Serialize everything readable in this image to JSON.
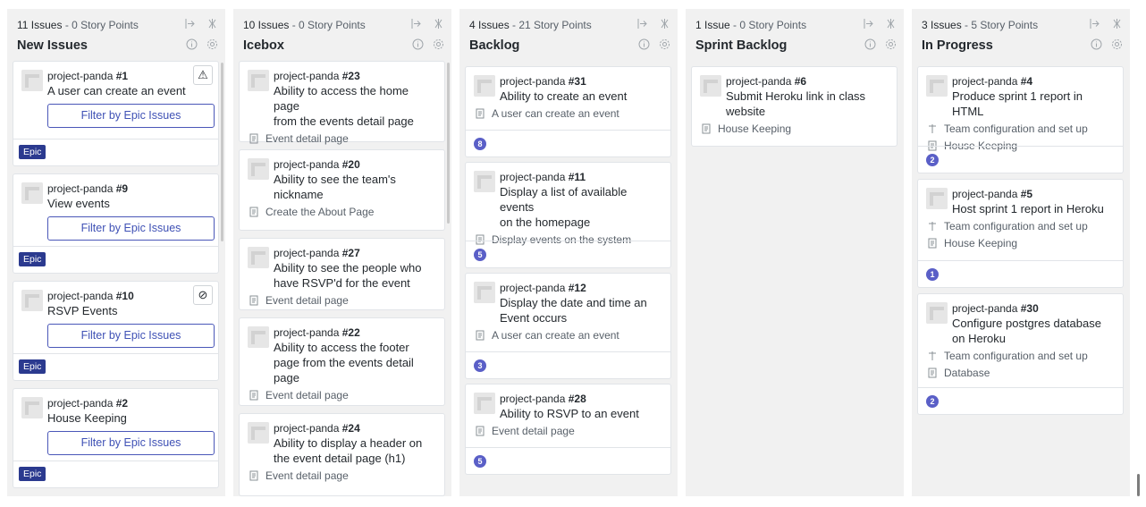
{
  "columns": [
    {
      "count": "11 Issues",
      "points": " - 0 Story Points",
      "title": "New Issues",
      "cards": [
        {
          "ref_repo": "project-panda ",
          "ref_num": "#1",
          "title": "A user can create an event",
          "button": "Filter by Epic Issues",
          "corner": "⚠",
          "tag": "Epic"
        },
        {
          "ref_repo": "project-panda ",
          "ref_num": "#9",
          "title": "View events",
          "button": "Filter by Epic Issues",
          "tag": "Epic"
        },
        {
          "ref_repo": "project-panda ",
          "ref_num": "#10",
          "title": "RSVP Events",
          "button": "Filter by Epic Issues",
          "corner": "⊘",
          "tag": "Epic"
        },
        {
          "ref_repo": "project-panda ",
          "ref_num": "#2",
          "title": "House Keeping",
          "button": "Filter by Epic Issues",
          "tag": "Epic"
        }
      ]
    },
    {
      "count": "10 Issues",
      "points": " - 0 Story Points",
      "title": "Icebox",
      "cards": [
        {
          "ref_repo": "project-panda ",
          "ref_num": "#23",
          "title_lines": [
            "Ability to access the home page",
            "from the events detail page"
          ],
          "epic": "Event detail page"
        },
        {
          "ref_repo": "project-panda ",
          "ref_num": "#20",
          "title_lines": [
            "Ability to see the team's",
            "nickname"
          ],
          "epic": "Create the About Page"
        },
        {
          "ref_repo": "project-panda ",
          "ref_num": "#27",
          "title_lines": [
            "Ability to see the people who",
            "have RSVP'd for the event"
          ],
          "epic": "Event detail page"
        },
        {
          "ref_repo": "project-panda ",
          "ref_num": "#22",
          "title_lines": [
            "Ability to access the footer",
            "page from the events detail",
            "page"
          ],
          "epic": "Event detail page"
        },
        {
          "ref_repo": "project-panda ",
          "ref_num": "#24",
          "title_lines": [
            "Ability to display a header on",
            "the event detail page (h1)"
          ],
          "epic": "Event detail page"
        }
      ]
    },
    {
      "count": "4 Issues",
      "points": " - 21 Story Points",
      "title": "Backlog",
      "cards": [
        {
          "ref_repo": "project-panda ",
          "ref_num": "#31",
          "title_lines": [
            "Ability to create an event"
          ],
          "epic": "A user can create an event",
          "points": "8"
        },
        {
          "ref_repo": "project-panda ",
          "ref_num": "#11",
          "title_lines": [
            "Display a list of available events",
            "on the homepage"
          ],
          "epic": "Display events on the system",
          "points": "5"
        },
        {
          "ref_repo": "project-panda ",
          "ref_num": "#12",
          "title_lines": [
            "Display the date and time an",
            "Event occurs"
          ],
          "epic": "A user can create an event",
          "points": "3"
        },
        {
          "ref_repo": "project-panda ",
          "ref_num": "#28",
          "title_lines": [
            "Ability to RSVP to an event"
          ],
          "epic": "Event detail page",
          "points": "5"
        }
      ]
    },
    {
      "count": "1 Issue",
      "points": " - 0 Story Points",
      "title": "Sprint Backlog",
      "cards": [
        {
          "ref_repo": "project-panda ",
          "ref_num": "#6",
          "title_lines": [
            "Submit Heroku link in class",
            "website"
          ],
          "epic": "House Keeping"
        }
      ]
    },
    {
      "count": "3 Issues",
      "points": " - 5 Story Points",
      "title": "In Progress",
      "cards": [
        {
          "ref_repo": "project-panda ",
          "ref_num": "#4",
          "title_lines": [
            "Produce sprint 1 report in HTML"
          ],
          "milestone": "Team configuration and set up",
          "epic": "House Keeping",
          "points": "2"
        },
        {
          "ref_repo": "project-panda ",
          "ref_num": "#5",
          "title_lines": [
            "Host sprint 1 report in Heroku"
          ],
          "milestone": "Team configuration and set up",
          "epic": "House Keeping",
          "points": "1"
        },
        {
          "ref_repo": "project-panda ",
          "ref_num": "#30",
          "title_lines": [
            "Configure postgres database",
            "on Heroku"
          ],
          "milestone": "Team configuration and set up",
          "epic": "Database",
          "points": "2"
        }
      ]
    }
  ],
  "colors": {
    "epic_tag": "#2b3a8f",
    "points_badge": "#5a5fc7",
    "filter_button": "#3f51b5"
  },
  "icons": {
    "collapse": "collapse-icon",
    "expand": "expand-icon",
    "info": "info-icon",
    "settings": "gear-icon",
    "epic": "epic-book-icon",
    "milestone": "milestone-signpost-icon"
  }
}
